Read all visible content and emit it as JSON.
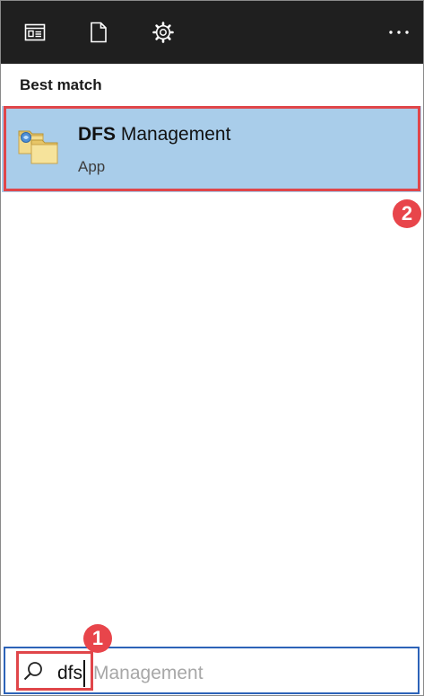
{
  "toolbar": {
    "icons": [
      "apps-view-icon",
      "document-icon",
      "settings-gear-icon",
      "more-options-icon"
    ],
    "more_label": "···"
  },
  "section": {
    "title": "Best match"
  },
  "best_match": {
    "name_bold": "DFS",
    "name_rest": "Management",
    "type": "App",
    "icon": "dfs-folder-icon"
  },
  "search": {
    "typed": "dfs",
    "suggestion": "Management",
    "icon": "search-icon"
  },
  "annotations": {
    "step1": "1",
    "step2": "2"
  },
  "colors": {
    "topbar": "#1f1f1f",
    "selection": "#a9cdea",
    "highlight_outline": "#e0464a",
    "badge": "#e8454b",
    "search_border": "#2d63b8",
    "suggestion_text": "#a7a7a7"
  }
}
